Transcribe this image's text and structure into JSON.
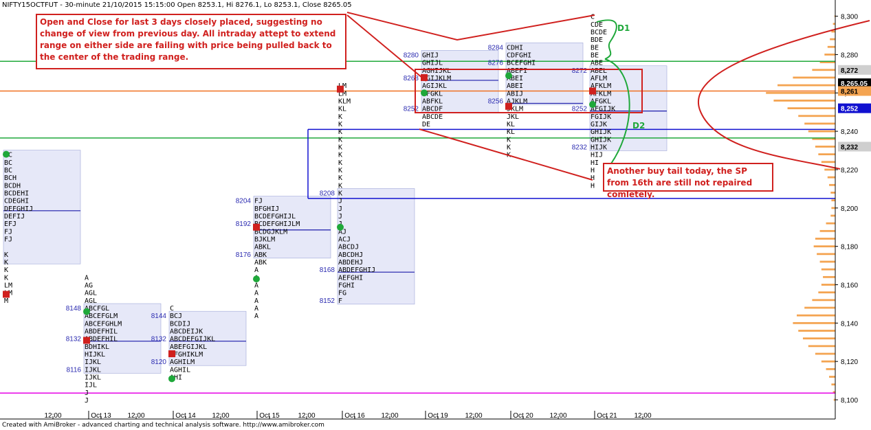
{
  "header": {
    "symbol": "NIFTY15OCTFUT",
    "interval": "30-minute",
    "datetime": "21/10/2015 15:15:00",
    "ohlc": "Open 8253.1, Hi 8276.1, Lo 8253.1, Close 8265.05"
  },
  "credit": "Created with AmiBroker - advanced charting and technical analysis software. http://www.amibroker.com",
  "colors": {
    "value_area": "#e6e8f8",
    "value_area_border": "#9ea6d8",
    "poc": "#1a1aaa",
    "profile": "#f4a451",
    "annotation": "#d0201e",
    "green": "#1fa83a",
    "magenta": "#e600e6",
    "orange_line": "#f07020",
    "blue_line": "#1010d0",
    "label_blue": "#2a2ab0"
  },
  "annotations": {
    "note1": "Open and Close for last 3 days closely placed, suggesting no change of view from previous day. All intraday attept to extend range on either side are failing with price being pulled back to the center of the trading range.",
    "note2": "Another buy tail today, the SP from 16th are still not repaired comletely.",
    "d1": "D1",
    "d2": "D2"
  },
  "chart_data": {
    "type": "market_profile",
    "ylim": [
      8095,
      8302
    ],
    "y_ticks": [
      8100,
      8120,
      8140,
      8160,
      8180,
      8200,
      8220,
      8240,
      8260,
      8280,
      8300
    ],
    "x_ticks": [
      "12:00",
      "Oct 13",
      "12:00",
      "Oct 14",
      "12:00",
      "Oct 15",
      "12:00",
      "Oct 16",
      "12:00",
      "Oct 19",
      "12:00",
      "Oct 20",
      "12:00",
      "Oct 21",
      "12:00"
    ],
    "price_badges": [
      {
        "label": "8,272",
        "value": 8272,
        "style": "grey"
      },
      {
        "label": "8,265.05",
        "value": 8265.05,
        "style": "black"
      },
      {
        "label": "8,261",
        "value": 8261,
        "style": "orange"
      },
      {
        "label": "8,252",
        "value": 8252,
        "style": "blue"
      },
      {
        "label": "8,232",
        "value": 8232,
        "style": "grey"
      }
    ],
    "horizontal_lines": [
      {
        "value": 8276.5,
        "color": "green"
      },
      {
        "value": 8261,
        "color": "orange"
      },
      {
        "value": 8241,
        "color": "blue"
      },
      {
        "value": 8236.5,
        "color": "green"
      },
      {
        "value": 8205,
        "color": "blue"
      },
      {
        "value": 8103.5,
        "color": "magenta"
      }
    ],
    "sessions": [
      {
        "day": "Oct 12",
        "col": 0,
        "va": [
          8173,
          8228
        ],
        "poc": 8200,
        "labels": [],
        "open": 8228,
        "close": 8155,
        "rows": [
          [
            8228,
            "BC"
          ],
          [
            8224,
            "BC"
          ],
          [
            8220,
            "BC"
          ],
          [
            8216,
            "BCH"
          ],
          [
            8212,
            "BCDH"
          ],
          [
            8208,
            "BCDEHI"
          ],
          [
            8204,
            "CDEGHI"
          ],
          [
            8200,
            "DEFGHIJ"
          ],
          [
            8196,
            "DEFIJ"
          ],
          [
            8192,
            "EFJ"
          ],
          [
            8188,
            "FJ"
          ],
          [
            8184,
            "FJ"
          ],
          [
            8176,
            "K"
          ],
          [
            8172,
            "K"
          ],
          [
            8168,
            "K"
          ],
          [
            8164,
            "K"
          ],
          [
            8160,
            "LM"
          ],
          [
            8156,
            "LM"
          ],
          [
            8152,
            "M"
          ]
        ]
      },
      {
        "day": "Oct 13",
        "col": 1,
        "va": [
          8116,
          8148
        ],
        "poc": 8132,
        "labels": [
          [
            8148,
            "8148"
          ],
          [
            8132,
            "8132"
          ],
          [
            8116,
            "8116"
          ]
        ],
        "open": 8146,
        "close": 8131,
        "rows": [
          [
            8164,
            "A"
          ],
          [
            8160,
            "AG"
          ],
          [
            8156,
            "AGL"
          ],
          [
            8152,
            "AGL"
          ],
          [
            8148,
            "ABCFGL"
          ],
          [
            8144,
            "ABCEFGLM"
          ],
          [
            8140,
            "ABCEFGHLM"
          ],
          [
            8136,
            "ABDEFHIL"
          ],
          [
            8132,
            "ABDEFHIL"
          ],
          [
            8128,
            "BDHIKL"
          ],
          [
            8124,
            "HIJKL"
          ],
          [
            8120,
            "IJKL"
          ],
          [
            8116,
            "IJKL"
          ],
          [
            8112,
            "IJKL"
          ],
          [
            8108,
            "IJL"
          ],
          [
            8104,
            "J"
          ],
          [
            8100,
            "J"
          ]
        ]
      },
      {
        "day": "Oct 14",
        "col": 2,
        "va": [
          8120,
          8144
        ],
        "poc": 8132,
        "labels": [
          [
            8144,
            "8144"
          ],
          [
            8132,
            "8132"
          ],
          [
            8120,
            "8120"
          ]
        ],
        "open": 8111,
        "close": 8124,
        "rows": [
          [
            8148,
            "C"
          ],
          [
            8144,
            "BCJ"
          ],
          [
            8140,
            "BCDIJ"
          ],
          [
            8136,
            "ABCDEIJK"
          ],
          [
            8132,
            "ABCDEFGIJKL"
          ],
          [
            8128,
            "ABEFGIJKL"
          ],
          [
            8124,
            "AFGHIKLM"
          ],
          [
            8120,
            "AGHILM"
          ],
          [
            8116,
            "AGHIL"
          ],
          [
            8112,
            "AHI"
          ]
        ]
      },
      {
        "day": "Oct 15",
        "col": 3,
        "va": [
          8176,
          8204
        ],
        "poc": 8190,
        "labels": [
          [
            8204,
            "8204"
          ],
          [
            8192,
            "8192"
          ],
          [
            8176,
            "8176"
          ]
        ],
        "open": 8163,
        "close": 8190,
        "rows": [
          [
            8204,
            "FJ"
          ],
          [
            8200,
            "BFGHIJ"
          ],
          [
            8196,
            "BCDEFGHIJL"
          ],
          [
            8192,
            "BCDEFGHIJLM"
          ],
          [
            8188,
            "BCDGJKLM"
          ],
          [
            8184,
            "BJKLM"
          ],
          [
            8180,
            "ABKL"
          ],
          [
            8176,
            "ABK"
          ],
          [
            8172,
            "ABK"
          ],
          [
            8168,
            "A"
          ],
          [
            8164,
            "A"
          ],
          [
            8160,
            "A"
          ],
          [
            8156,
            "A"
          ],
          [
            8152,
            "A"
          ],
          [
            8148,
            "A"
          ],
          [
            8144,
            "A"
          ]
        ]
      },
      {
        "day": "Oct 16",
        "col": 4,
        "va": [
          8152,
          8208
        ],
        "poc": 8168,
        "labels": [
          [
            8208,
            "8208"
          ],
          [
            8168,
            "8168"
          ],
          [
            8152,
            "8152"
          ]
        ],
        "open": 8190,
        "close": 8262,
        "rows": [
          [
            8264,
            "LM"
          ],
          [
            8260,
            "LM"
          ],
          [
            8256,
            "KLM"
          ],
          [
            8252,
            "KL"
          ],
          [
            8248,
            "K"
          ],
          [
            8244,
            "K"
          ],
          [
            8240,
            "K"
          ],
          [
            8236,
            "K"
          ],
          [
            8232,
            "K"
          ],
          [
            8228,
            "K"
          ],
          [
            8224,
            "K"
          ],
          [
            8220,
            "K"
          ],
          [
            8216,
            "K"
          ],
          [
            8212,
            "K"
          ],
          [
            8208,
            "K"
          ],
          [
            8204,
            "J"
          ],
          [
            8200,
            "J"
          ],
          [
            8196,
            "J"
          ],
          [
            8192,
            "J"
          ],
          [
            8188,
            "AJ"
          ],
          [
            8184,
            "ACJ"
          ],
          [
            8180,
            "ABCDJ"
          ],
          [
            8176,
            "ABCDHJ"
          ],
          [
            8172,
            "ABDEHJ"
          ],
          [
            8168,
            "ABDEFGHIJ"
          ],
          [
            8164,
            "AEFGHI"
          ],
          [
            8160,
            "FGHI"
          ],
          [
            8156,
            "FG"
          ],
          [
            8152,
            "F"
          ]
        ]
      },
      {
        "day": "Oct 19",
        "col": 5,
        "va": [
          8252,
          8280
        ],
        "poc": 8268,
        "labels": [
          [
            8280,
            "8280"
          ],
          [
            8268,
            "8268"
          ],
          [
            8252,
            "8252"
          ]
        ],
        "open": 8260,
        "close": 8268,
        "rows": [
          [
            8280,
            "GHIJ"
          ],
          [
            8276,
            "GHIJL"
          ],
          [
            8272,
            "AGHIJKL"
          ],
          [
            8268,
            "AGIJKLM"
          ],
          [
            8264,
            "AGIJKL"
          ],
          [
            8260,
            "AFGKL"
          ],
          [
            8256,
            "ABFKL"
          ],
          [
            8252,
            "ABCDF"
          ],
          [
            8248,
            "ABCDE"
          ],
          [
            8244,
            "DE"
          ]
        ]
      },
      {
        "day": "Oct 20",
        "col": 6,
        "va": [
          8256,
          8284
        ],
        "poc": 8256,
        "labels": [
          [
            8284,
            "8284"
          ],
          [
            8276,
            "8276"
          ],
          [
            8256,
            "8256"
          ]
        ],
        "open": 8269,
        "close": 8253,
        "rows": [
          [
            8284,
            "CDHI"
          ],
          [
            8280,
            "CDFGHI"
          ],
          [
            8276,
            "BCEFGHI"
          ],
          [
            8272,
            "ABEFI"
          ],
          [
            8268,
            "ABEI"
          ],
          [
            8264,
            "ABEI"
          ],
          [
            8260,
            "ABIJ"
          ],
          [
            8256,
            "AJKLM"
          ],
          [
            8252,
            "JKLM"
          ],
          [
            8248,
            "JKL"
          ],
          [
            8244,
            "KL"
          ],
          [
            8240,
            "KL"
          ],
          [
            8236,
            "K"
          ],
          [
            8232,
            "K"
          ],
          [
            8228,
            "K"
          ]
        ]
      },
      {
        "day": "Oct 21",
        "col": 7,
        "va": [
          8232,
          8272
        ],
        "poc": 8252,
        "labels": [
          [
            8272,
            "8272"
          ],
          [
            8252,
            "8252"
          ],
          [
            8232,
            "8232"
          ]
        ],
        "open": 8254,
        "close": 8261,
        "rows": [
          [
            8300,
            "C"
          ],
          [
            8296,
            "CDE"
          ],
          [
            8292,
            "BCDE"
          ],
          [
            8288,
            "BDE"
          ],
          [
            8284,
            "BE"
          ],
          [
            8280,
            "BE"
          ],
          [
            8276,
            "ABE"
          ],
          [
            8272,
            "ABEL"
          ],
          [
            8268,
            "AFLM"
          ],
          [
            8264,
            "AFKLM"
          ],
          [
            8260,
            "AFKLM"
          ],
          [
            8256,
            "AFGKL"
          ],
          [
            8252,
            "AFGIJK"
          ],
          [
            8248,
            "FGIJK"
          ],
          [
            8244,
            "GIJK"
          ],
          [
            8240,
            "GHIJK"
          ],
          [
            8236,
            "GHIJK"
          ],
          [
            8232,
            "HIJK"
          ],
          [
            8228,
            "HIJ"
          ],
          [
            8224,
            "HI"
          ],
          [
            8220,
            "H"
          ],
          [
            8216,
            "H"
          ],
          [
            8212,
            "H"
          ]
        ]
      }
    ],
    "volume_profile": [
      [
        8300,
        1
      ],
      [
        8296,
        3
      ],
      [
        8292,
        5
      ],
      [
        8288,
        7
      ],
      [
        8284,
        10
      ],
      [
        8280,
        14
      ],
      [
        8276,
        20
      ],
      [
        8272,
        30
      ],
      [
        8268,
        55
      ],
      [
        8264,
        75
      ],
      [
        8260,
        90
      ],
      [
        8256,
        80
      ],
      [
        8252,
        62
      ],
      [
        8248,
        48
      ],
      [
        8244,
        40
      ],
      [
        8240,
        35
      ],
      [
        8236,
        30
      ],
      [
        8232,
        26
      ],
      [
        8228,
        22
      ],
      [
        8224,
        18
      ],
      [
        8220,
        14
      ],
      [
        8216,
        10
      ],
      [
        8212,
        8
      ],
      [
        8208,
        6
      ],
      [
        8204,
        5
      ],
      [
        8200,
        5
      ],
      [
        8196,
        6
      ],
      [
        8192,
        12
      ],
      [
        8188,
        20
      ],
      [
        8184,
        26
      ],
      [
        8180,
        28
      ],
      [
        8176,
        24
      ],
      [
        8172,
        20
      ],
      [
        8168,
        18
      ],
      [
        8164,
        16
      ],
      [
        8160,
        18
      ],
      [
        8156,
        22
      ],
      [
        8152,
        30
      ],
      [
        8148,
        40
      ],
      [
        8144,
        50
      ],
      [
        8140,
        55
      ],
      [
        8136,
        48
      ],
      [
        8132,
        42
      ],
      [
        8128,
        35
      ],
      [
        8124,
        26
      ],
      [
        8120,
        18
      ],
      [
        8116,
        12
      ],
      [
        8112,
        8
      ],
      [
        8108,
        5
      ],
      [
        8104,
        3
      ],
      [
        8100,
        2
      ]
    ]
  }
}
